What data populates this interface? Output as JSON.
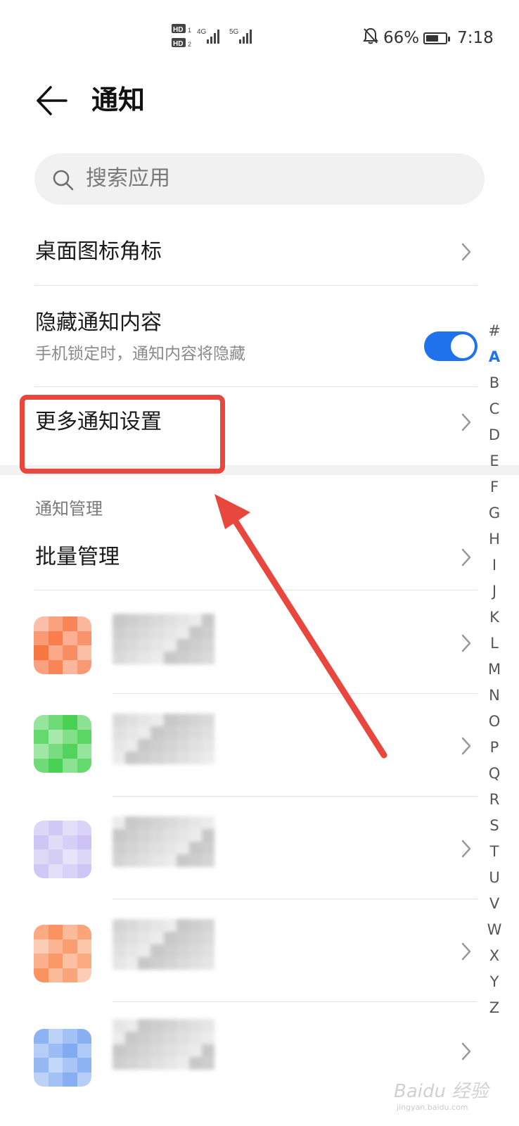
{
  "status_bar": {
    "sim1_label": "HD",
    "sim1_index": "1",
    "sim2_label": "HD",
    "sim2_index": "2",
    "network1": "4G",
    "network2": "5G",
    "battery_percent": "66%",
    "battery_level": 0.66,
    "time": "7:18",
    "icons": [
      "signal-icon",
      "mute-bell-icon",
      "battery-icon"
    ]
  },
  "header": {
    "title": "通知",
    "back_icon": "back-arrow-icon"
  },
  "search": {
    "placeholder": "搜索应用",
    "icon": "search-icon"
  },
  "settings": {
    "badge": {
      "label": "桌面图标角标"
    },
    "hide_content": {
      "label": "隐藏通知内容",
      "sublabel": "手机锁定时，通知内容将隐藏",
      "enabled": true
    },
    "more": {
      "label": "更多通知设置"
    }
  },
  "manage": {
    "section_header": "通知管理",
    "batch": {
      "label": "批量管理"
    }
  },
  "apps": [
    {
      "icon_color": "#f86f3a"
    },
    {
      "icon_color": "#3fcf4a"
    },
    {
      "icon_color": "#c9c0f3"
    },
    {
      "icon_color": "#f98d58"
    },
    {
      "icon_color": "#7aa6f0"
    }
  ],
  "alphabet": [
    "#",
    "A",
    "B",
    "C",
    "D",
    "E",
    "F",
    "G",
    "H",
    "I",
    "J",
    "K",
    "L",
    "M",
    "N",
    "O",
    "P",
    "Q",
    "R",
    "S",
    "T",
    "U",
    "V",
    "W",
    "X",
    "Y",
    "Z"
  ],
  "alphabet_active": "A",
  "colors": {
    "accent": "#1f72ec",
    "annotation": "#e8473d"
  },
  "watermark": {
    "brand": "Baidu 经验",
    "url": "jingyan.baidu.com"
  }
}
